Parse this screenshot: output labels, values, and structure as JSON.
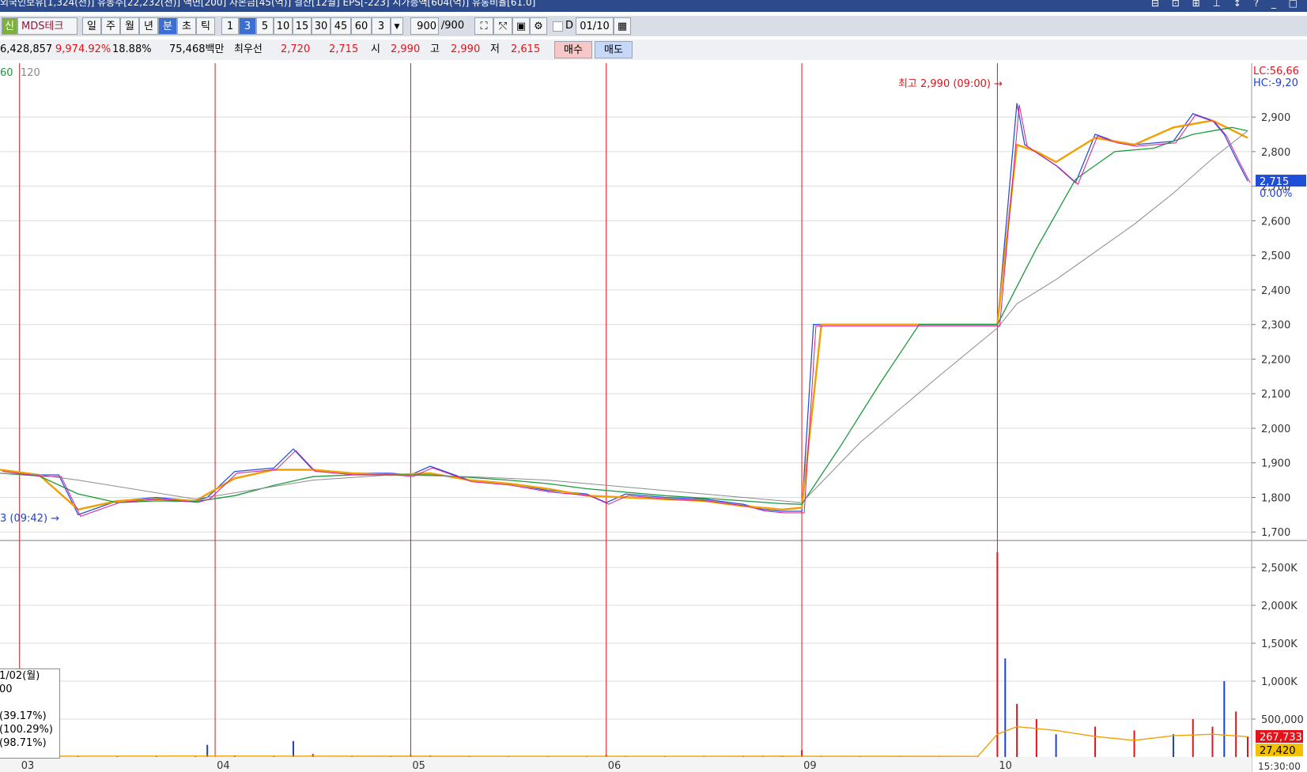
{
  "titlebar": {
    "text": "외국인보유[1,324(천)] 유동주[22,232(천)] 액면[200] 자본금[45(억)] 결산[12월] EPS[-223] 시가총액[604(억)] 유통비율[61.0]",
    "window_controls": "⊟ ⊡ ⊞ ⊥ ↕ ? _ □"
  },
  "toolbar": {
    "stock_badge": "신",
    "stock_name": "MDS테크",
    "period_buttons": [
      "일",
      "주",
      "월",
      "년",
      "분",
      "초",
      "틱"
    ],
    "selected_period": "분",
    "interval_buttons": [
      "1",
      "3",
      "5",
      "10",
      "15",
      "30",
      "45",
      "60"
    ],
    "selected_interval": "3",
    "interval_input": "3",
    "count_value": "900",
    "count_total": "/900",
    "date_prefix": "D",
    "date_value": "01/10"
  },
  "quote": {
    "volume": "6,428,857",
    "volume_ratio": "9,974.92%",
    "turnover": "18.88%",
    "amount": "75,468백만",
    "best_bid_label": "최우선",
    "best_ask": "2,720",
    "best_bid": "2,715",
    "open_label": "시",
    "open": "2,990",
    "high_label": "고",
    "high": "2,990",
    "low_label": "저",
    "low": "2,615",
    "buy_label": "매수",
    "sell_label": "매도"
  },
  "colors": {
    "up": "#e0141a",
    "down": "#1f3fd6",
    "ma5": "#d81b9a",
    "ma10": "#2a52d8",
    "ma20": "#f0a000",
    "ma60": "#1a9a3a",
    "ma120": "#8c8c8c",
    "current_price_bg": "#1f4fd6",
    "volume_badge_bg": "#e0141a",
    "volume_badge2_bg": "#f5c000"
  },
  "chart_data": [
    {
      "type": "line",
      "legend": [
        "60",
        "120"
      ],
      "x_tick_labels": [
        "03",
        "04",
        "05",
        "06",
        "09",
        "10"
      ],
      "y_tick_labels": [
        "2,900",
        "2,800",
        "2,700",
        "2,600",
        "2,500",
        "2,400",
        "2,300",
        "2,200",
        "2,100",
        "2,000",
        "1,900",
        "1,800",
        "1,700"
      ],
      "ylim": [
        1680,
        3010
      ],
      "day_starts": [
        0.5,
        5.5,
        10.5,
        15.5,
        20.5,
        25.5
      ],
      "series": [
        {
          "name": "price",
          "x": [
            0,
            1,
            1.5,
            2,
            3,
            4,
            5,
            5.3,
            6,
            7,
            7.5,
            8,
            9,
            10,
            10.5,
            11,
            12,
            13,
            14,
            15,
            15.5,
            16,
            17,
            18,
            19,
            19.5,
            20,
            20.5,
            20.8,
            21,
            21.2,
            21.5,
            22,
            23,
            24,
            25,
            25.5,
            26,
            26.2,
            26.6,
            27,
            27.5,
            28,
            28.5,
            29,
            30,
            30.5,
            31,
            31.3,
            31.6,
            31.9
          ],
          "values": [
            1880,
            1865,
            1865,
            1750,
            1790,
            1800,
            1790,
            1800,
            1875,
            1885,
            1940,
            1880,
            1870,
            1870,
            1865,
            1890,
            1850,
            1840,
            1820,
            1810,
            1785,
            1810,
            1800,
            1795,
            1780,
            1765,
            1760,
            1760,
            2300,
            2300,
            2300,
            2300,
            2300,
            2300,
            2300,
            2300,
            2300,
            2940,
            2820,
            2790,
            2760,
            2710,
            2850,
            2830,
            2820,
            2830,
            2910,
            2890,
            2850,
            2780,
            2715
          ]
        },
        {
          "name": "ma20",
          "x": [
            0,
            1,
            2,
            3,
            4,
            5,
            6,
            7,
            8,
            9,
            10,
            11,
            12,
            13,
            14,
            15,
            16,
            17,
            18,
            19,
            20,
            20.5,
            21,
            21.5,
            22,
            23,
            24,
            25,
            25.5,
            26,
            26.5,
            27,
            28,
            29,
            30,
            31,
            31.9
          ],
          "values": [
            1880,
            1865,
            1765,
            1790,
            1795,
            1790,
            1855,
            1880,
            1880,
            1870,
            1865,
            1870,
            1850,
            1840,
            1825,
            1805,
            1800,
            1795,
            1790,
            1775,
            1765,
            1770,
            2300,
            2300,
            2300,
            2300,
            2300,
            2300,
            2300,
            2820,
            2800,
            2770,
            2840,
            2820,
            2870,
            2890,
            2840
          ]
        },
        {
          "name": "ma60",
          "x": [
            0,
            1,
            2,
            3,
            4,
            5,
            6,
            7,
            8,
            9,
            10,
            11,
            12,
            13,
            14,
            15,
            16,
            17,
            18,
            19,
            20,
            20.5,
            21.5,
            22.5,
            23.5,
            24.5,
            25.5,
            26.5,
            27.5,
            28.5,
            29.5,
            30.5,
            31.5,
            31.9
          ],
          "values": [
            1870,
            1862,
            1810,
            1785,
            1790,
            1788,
            1805,
            1835,
            1860,
            1865,
            1865,
            1865,
            1858,
            1850,
            1840,
            1825,
            1815,
            1805,
            1798,
            1790,
            1782,
            1780,
            1950,
            2130,
            2300,
            2300,
            2300,
            2520,
            2720,
            2800,
            2810,
            2850,
            2870,
            2860
          ]
        },
        {
          "name": "ma120",
          "x": [
            0,
            1,
            2,
            5,
            8,
            10,
            12,
            14,
            16,
            18,
            20,
            20.5,
            22,
            24,
            25.5,
            26,
            27,
            28,
            29,
            30,
            31,
            31.9
          ],
          "values": [
            1870,
            1865,
            1850,
            1795,
            1850,
            1865,
            1860,
            1850,
            1830,
            1810,
            1790,
            1785,
            1960,
            2150,
            2290,
            2360,
            2430,
            2510,
            2590,
            2680,
            2780,
            2860
          ]
        }
      ],
      "annotations": {
        "high_marker": "최고 2,990 (09:00) →",
        "low_marker": "3 (09:42) →",
        "lc_label": "LC:56,66",
        "hc_label": "HC:-9,20",
        "current_price": "2,715",
        "change_pct": "0.00%"
      }
    },
    {
      "type": "bar",
      "y_tick_labels": [
        "2,500K",
        "2,000K",
        "1,500K",
        "1,000K",
        "500,000"
      ],
      "ylim": [
        0,
        2730000
      ],
      "series": [
        {
          "name": "volume",
          "x": [
            0,
            1,
            2,
            3,
            4,
            5,
            5.3,
            6,
            7,
            7.5,
            8,
            9,
            10,
            10.5,
            11,
            12,
            13,
            14,
            15,
            15.5,
            16,
            17,
            18,
            19,
            19.5,
            20,
            20.5,
            21,
            22,
            23,
            24,
            25,
            25.5,
            25.7,
            26,
            26.5,
            27,
            28,
            29,
            30,
            30.5,
            31,
            31.3,
            31.6,
            31.9
          ],
          "values": [
            10000,
            60000,
            15000,
            12000,
            10000,
            15000,
            160000,
            20000,
            15000,
            210000,
            40000,
            10000,
            8000,
            30000,
            20000,
            10000,
            8000,
            10000,
            8000,
            30000,
            15000,
            10000,
            8000,
            12000,
            8000,
            15000,
            90000,
            12000,
            5000,
            5000,
            5000,
            5000,
            2700000,
            1300000,
            700000,
            500000,
            300000,
            400000,
            350000,
            300000,
            500000,
            400000,
            1000000,
            600000,
            270000
          ]
        },
        {
          "name": "vol_ma",
          "x": [
            0,
            5,
            10,
            15,
            20,
            25,
            25.5,
            26,
            27,
            28,
            29,
            30,
            31,
            31.9
          ],
          "values": [
            10000,
            12000,
            10000,
            9000,
            10000,
            8000,
            300000,
            400000,
            350000,
            270000,
            220000,
            280000,
            300000,
            267733
          ]
        }
      ],
      "annotations": {
        "volume_badge": "267,733",
        "volume_badge2": "27,420",
        "clock_label": "15:30:00"
      }
    }
  ],
  "info_box": {
    "lines": [
      "1/02(월)",
      "00",
      "",
      "(39.17%)",
      "(100.29%)",
      "(98.71%)"
    ]
  }
}
